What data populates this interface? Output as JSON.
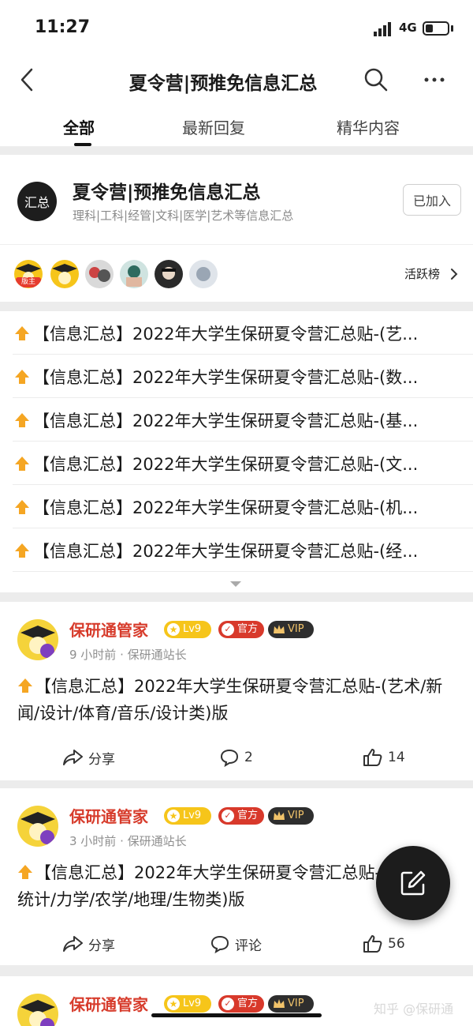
{
  "status_bar": {
    "time": "11:27",
    "network": "4G"
  },
  "nav": {
    "title": "夏令营|预推免信息汇总"
  },
  "tabs": [
    {
      "label": "全部",
      "active": true
    },
    {
      "label": "最新回复",
      "active": false
    },
    {
      "label": "精华内容",
      "active": false
    }
  ],
  "group": {
    "avatar_text": "汇总",
    "name": "夏令营|预推免信息汇总",
    "description": "理科|工科|经管|文科|医学|艺术等信息汇总",
    "join_status": "已加入",
    "moderator_tag": "版主",
    "active_rank_label": "活跃榜"
  },
  "pinned_posts": [
    "【信息汇总】2022年大学生保研夏令营汇总贴-(艺...",
    "【信息汇总】2022年大学生保研夏令营汇总贴-(数...",
    "【信息汇总】2022年大学生保研夏令营汇总贴-(基...",
    "【信息汇总】2022年大学生保研夏令营汇总贴-(文...",
    "【信息汇总】2022年大学生保研夏令营汇总贴-(机...",
    "【信息汇总】2022年大学生保研夏令营汇总贴-(经..."
  ],
  "posts": [
    {
      "author": "保研通管家",
      "level": "Lv9",
      "official": "官方",
      "vip": "VIP",
      "meta": "9 小时前 · 保研通站长",
      "title": "【信息汇总】2022年大学生保研夏令营汇总贴-(艺术/新闻/设计/体育/音乐/设计类)版",
      "share": "分享",
      "comments": "2",
      "likes": "14"
    },
    {
      "author": "保研通管家",
      "level": "Lv9",
      "official": "官方",
      "vip": "VIP",
      "meta": "3 小时前 · 保研通站长",
      "title": "【信息汇总】2022年大学生保研夏令营汇总贴-(数理化/统计/力学/农学/地理/生物类)版",
      "share": "分享",
      "comments": "评论",
      "likes": "56"
    },
    {
      "author": "保研通管家",
      "level": "Lv9",
      "official": "官方",
      "vip": "VIP"
    }
  ],
  "watermark": "知乎 @保研通",
  "colors": {
    "accent_red": "#d73c2c",
    "level_gold": "#f6c51a",
    "vip_dark": "#2e2e2e"
  }
}
